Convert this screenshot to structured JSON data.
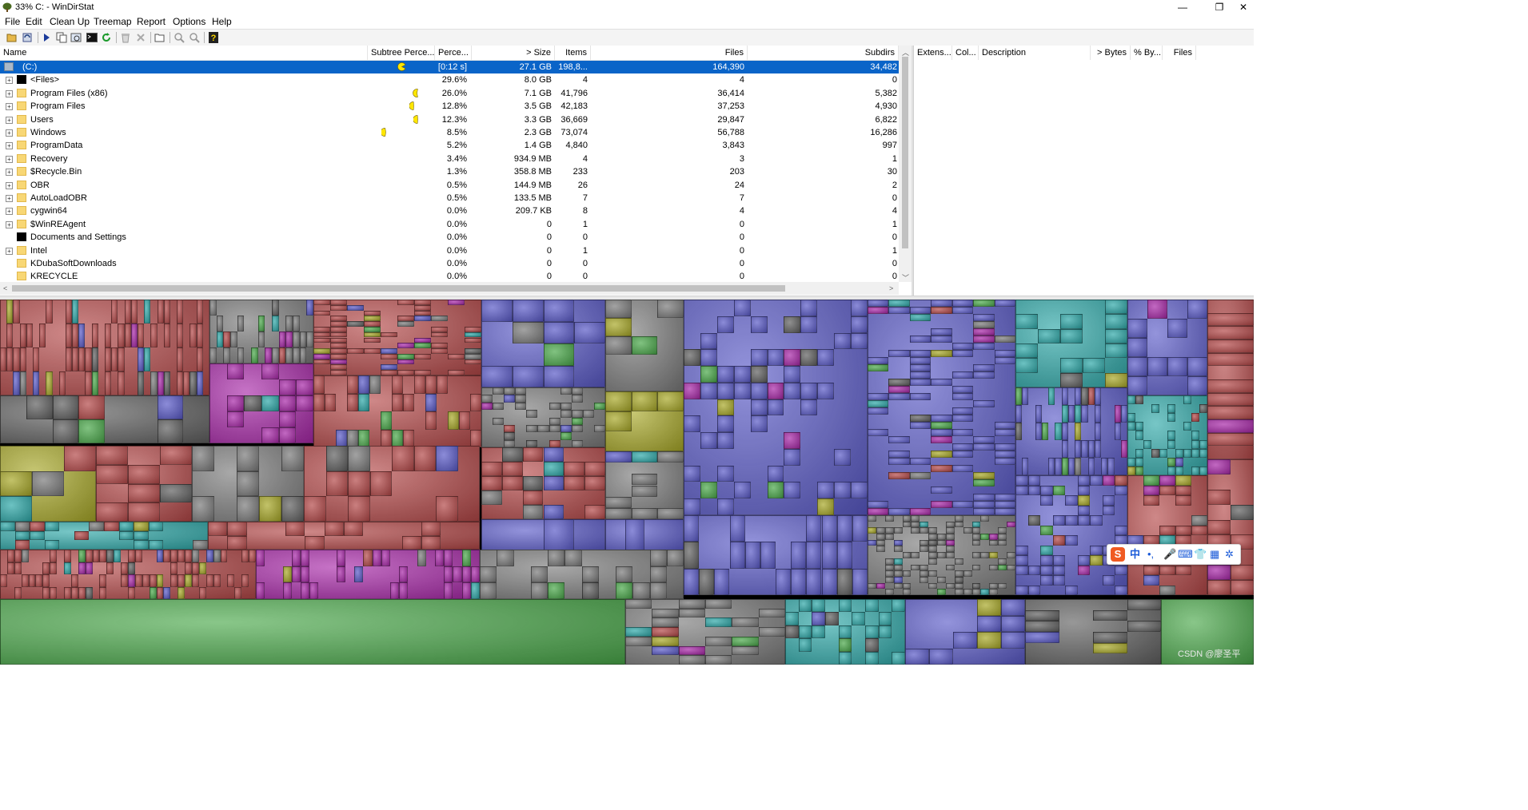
{
  "window": {
    "title": "33% C: - WinDirStat",
    "minimize": "—",
    "maximize": "❐",
    "close": "✕"
  },
  "menu": [
    "File",
    "Edit",
    "Clean Up",
    "Treemap",
    "Report",
    "Options",
    "Help"
  ],
  "toolbar": {
    "buttons": [
      "open-icon",
      "refresh-icon",
      "play-icon",
      "copy-icon",
      "explorer-icon",
      "command-prompt-icon",
      "refresh-green-icon",
      "recycle-icon",
      "delete-icon",
      "properties-icon",
      "zoom-in-icon",
      "zoom-out-icon",
      "help-icon"
    ]
  },
  "directory_list": {
    "columns": [
      "Name",
      "Subtree Perce...",
      "Perce...",
      "> Size",
      "Items",
      "Files",
      "Subdirs"
    ],
    "rows": [
      {
        "name": "(C:)",
        "percent": "[0:12 s]",
        "size": "27.1 GB",
        "items": "198,8...",
        "files": "164,390",
        "subdirs": "34,482",
        "icon": "drive",
        "selected": true,
        "pac_fill": 1.0
      },
      {
        "name": "<Files>",
        "percent": "29.6%",
        "size": "8.0 GB",
        "items": "4",
        "files": "4",
        "subdirs": "0",
        "icon": "black"
      },
      {
        "name": "Program Files (x86)",
        "percent": "26.0%",
        "size": "7.1 GB",
        "items": "41,796",
        "files": "36,414",
        "subdirs": "5,382",
        "icon": "folder",
        "pac_fill": 0.26
      },
      {
        "name": "Program Files",
        "percent": "12.8%",
        "size": "3.5 GB",
        "items": "42,183",
        "files": "37,253",
        "subdirs": "4,930",
        "icon": "folder",
        "pac_fill": 0.128
      },
      {
        "name": "Users",
        "percent": "12.3%",
        "size": "3.3 GB",
        "items": "36,669",
        "files": "29,847",
        "subdirs": "6,822",
        "icon": "folder",
        "pac_fill": 0.123
      },
      {
        "name": "Windows",
        "percent": "8.5%",
        "size": "2.3 GB",
        "items": "73,074",
        "files": "56,788",
        "subdirs": "16,286",
        "icon": "folder",
        "pac_fill": 0.085
      },
      {
        "name": "ProgramData",
        "percent": "5.2%",
        "size": "1.4 GB",
        "items": "4,840",
        "files": "3,843",
        "subdirs": "997",
        "icon": "folder"
      },
      {
        "name": "Recovery",
        "percent": "3.4%",
        "size": "934.9 MB",
        "items": "4",
        "files": "3",
        "subdirs": "1",
        "icon": "folder"
      },
      {
        "name": "$Recycle.Bin",
        "percent": "1.3%",
        "size": "358.8 MB",
        "items": "233",
        "files": "203",
        "subdirs": "30",
        "icon": "folder"
      },
      {
        "name": "OBR",
        "percent": "0.5%",
        "size": "144.9 MB",
        "items": "26",
        "files": "24",
        "subdirs": "2",
        "icon": "folder"
      },
      {
        "name": "AutoLoadOBR",
        "percent": "0.5%",
        "size": "133.5 MB",
        "items": "7",
        "files": "7",
        "subdirs": "0",
        "icon": "folder"
      },
      {
        "name": "cygwin64",
        "percent": "0.0%",
        "size": "209.7 KB",
        "items": "8",
        "files": "4",
        "subdirs": "4",
        "icon": "folder"
      },
      {
        "name": "$WinREAgent",
        "percent": "0.0%",
        "size": "0",
        "items": "1",
        "files": "0",
        "subdirs": "1",
        "icon": "folder"
      },
      {
        "name": "Documents and Settings",
        "percent": "0.0%",
        "size": "0",
        "items": "0",
        "files": "0",
        "subdirs": "0",
        "icon": "black"
      },
      {
        "name": "Intel",
        "percent": "0.0%",
        "size": "0",
        "items": "1",
        "files": "0",
        "subdirs": "1",
        "icon": "folder"
      },
      {
        "name": "KDubaSoftDownloads",
        "percent": "0.0%",
        "size": "0",
        "items": "0",
        "files": "0",
        "subdirs": "0",
        "icon": "folder"
      },
      {
        "name": "KRECYCLE",
        "percent": "0.0%",
        "size": "0",
        "items": "0",
        "files": "0",
        "subdirs": "0",
        "icon": "folder"
      }
    ]
  },
  "extension_list": {
    "columns": [
      "Extens...",
      "Col...",
      "Description",
      "> Bytes",
      "% By...",
      "Files"
    ]
  },
  "ime_bar": {
    "logo": "S",
    "lang": "中",
    "punct": "•,",
    "mic": "🎤",
    "keyboard": "⌨",
    "skin": "👕",
    "apps": "▦",
    "settings": "✲"
  },
  "watermark": "CSDN @廖圣平",
  "colors": {
    "selection": "#0a64c8",
    "pacman": "#ffe600",
    "treemap_palette": [
      "#5a5ac8",
      "#b44848",
      "#7a7a7a",
      "#2ea8a8",
      "#a8a828",
      "#a828a8",
      "#4aa84a",
      "#606060"
    ]
  }
}
